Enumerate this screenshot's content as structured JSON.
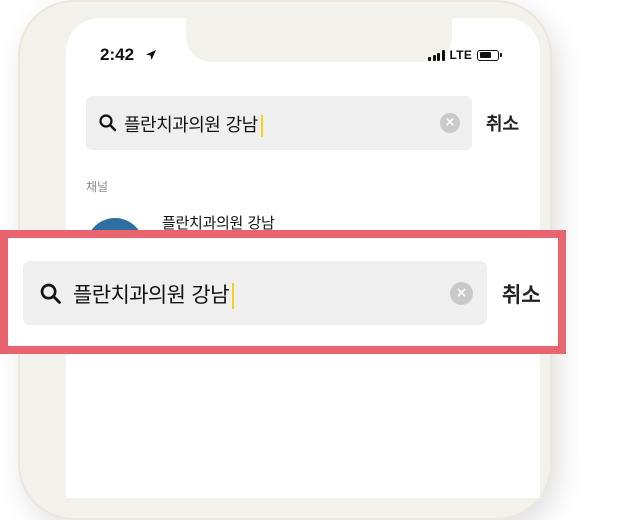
{
  "status_bar": {
    "time": "2:42",
    "network": "LTE",
    "battery_level": 0.7
  },
  "search": {
    "query": "플란치과의원 강남",
    "cancel_label": "취소"
  },
  "results": {
    "section_label": "채널",
    "items": [
      {
        "name": "플란치과의원 강남"
      }
    ]
  },
  "zoom_callout": {
    "query": "플란치과의원 강남",
    "cancel_label": "취소"
  },
  "colors": {
    "highlight": "#e8646e",
    "caret": "#f2d21a",
    "search_bg": "#efefef",
    "phone_frame": "#f3f1ec"
  },
  "icons": {
    "search": "search-icon",
    "clear": "clear-icon",
    "location": "location-arrow-icon"
  }
}
